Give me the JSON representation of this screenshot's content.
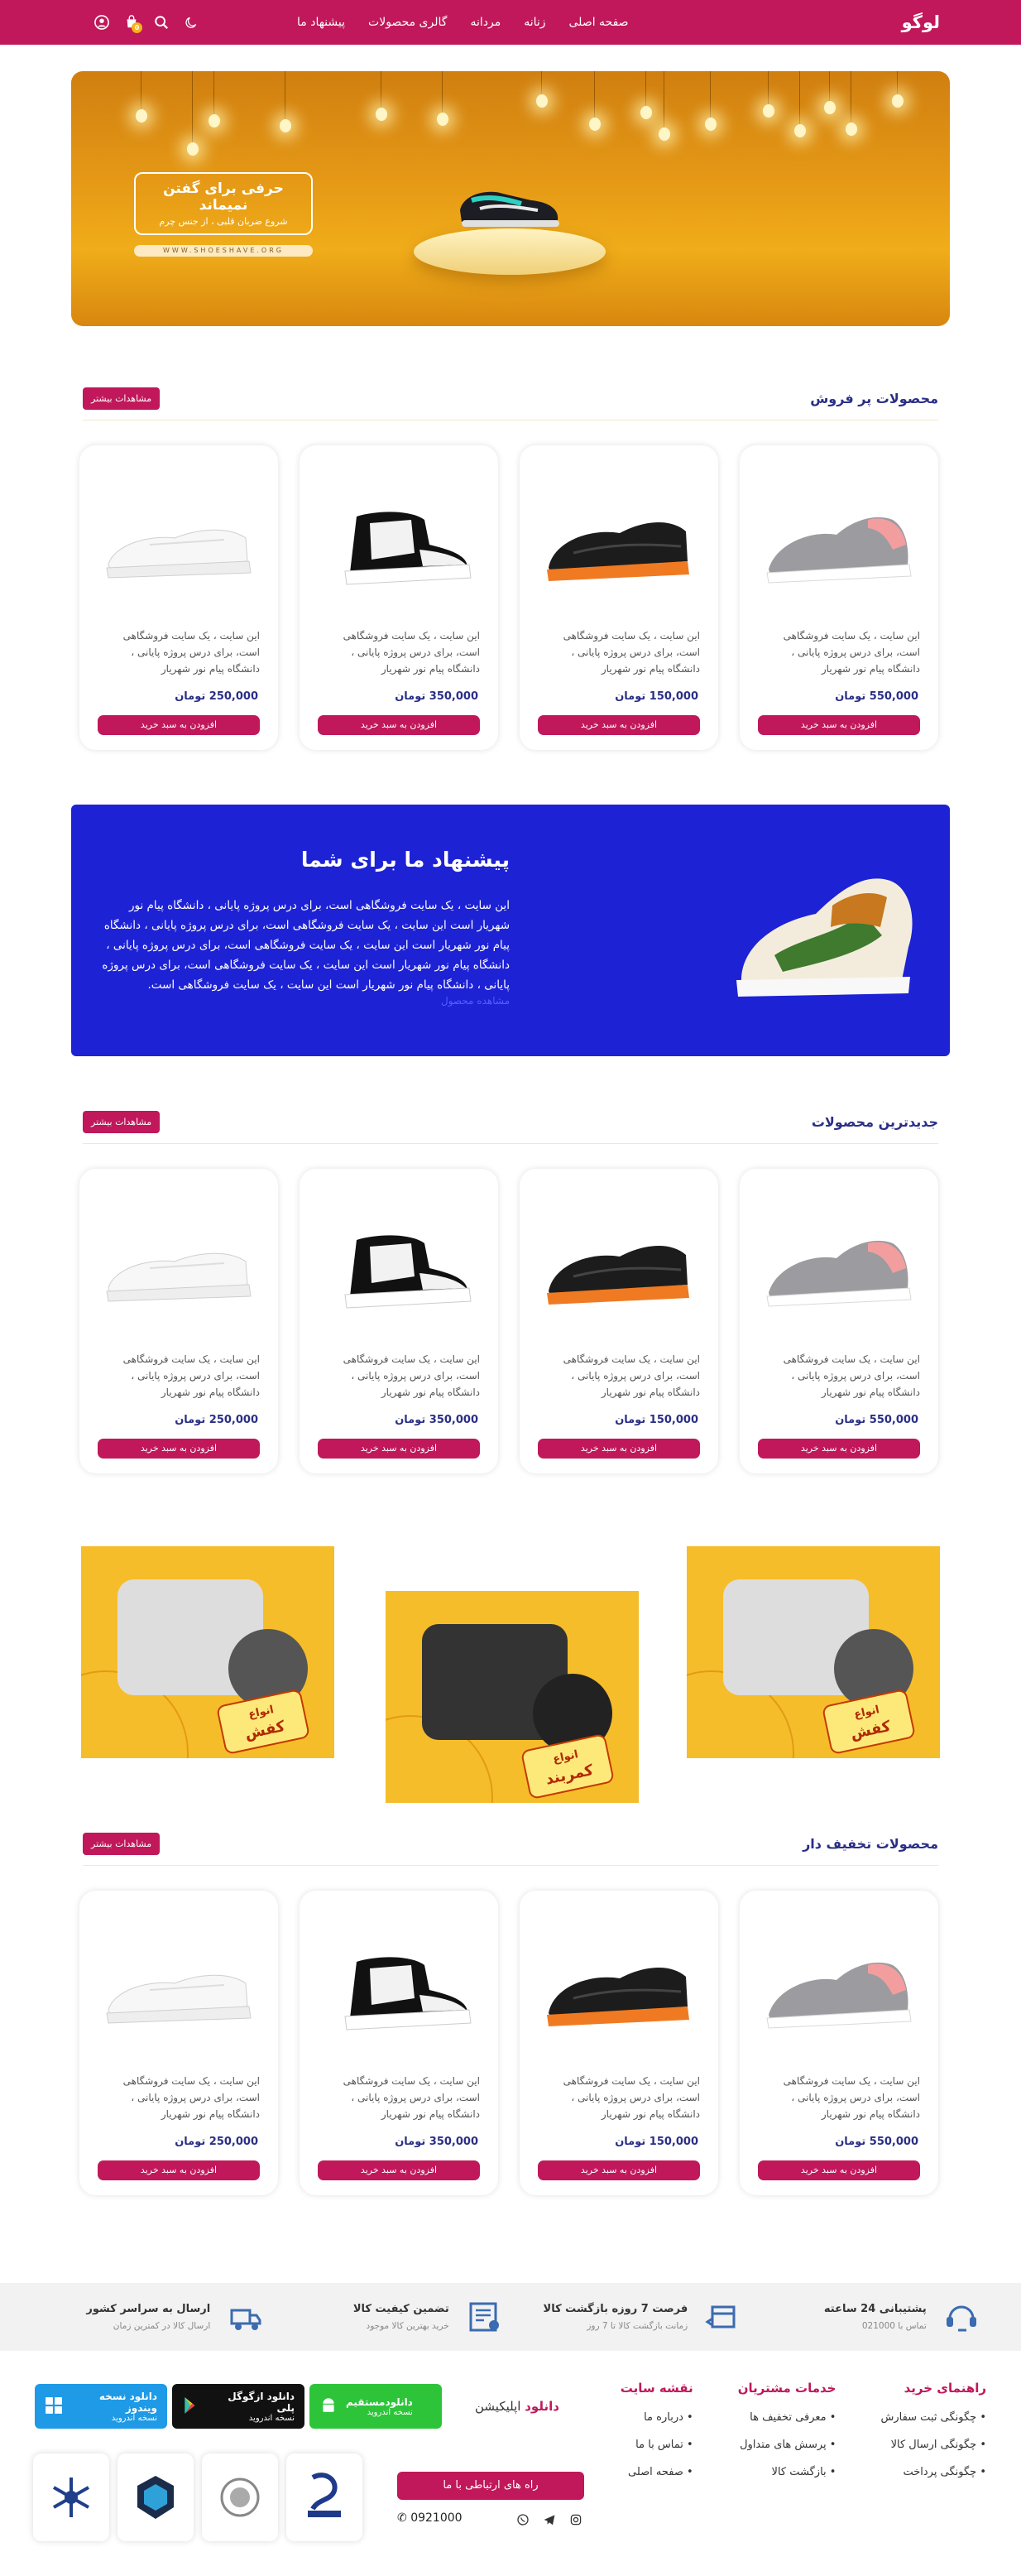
{
  "header": {
    "logo": "لوگو",
    "nav": [
      "صفحه اصلی",
      "زنانه",
      "مردانه",
      "گالری محصولات",
      "پیشنهاد ما"
    ],
    "cart_count": "0"
  },
  "hero": {
    "title": "حرفی برای گفتن نمیماند",
    "subtitle": "شروع ضربان قلبی ، از جنس چرم",
    "url": "WWW.SHOESHAVE.ORG"
  },
  "sections": [
    {
      "title": "محصولات پر فروش",
      "more": "مشاهدات بیشتر"
    },
    {
      "title": "جدیدترین محصولات",
      "more": "مشاهدات بیشتر"
    },
    {
      "title": "محصولات تخفیف دار",
      "more": "مشاهدات بیشتر"
    }
  ],
  "products": [
    {
      "desc": "این سایت ، یک سایت فروشگاهی است، برای درس پروژه پایانی ، دانشگاه پیام نور شهریار",
      "price": "550,000 تومان",
      "cart": "افزودن به سبد خرید"
    },
    {
      "desc": "این سایت ، یک سایت فروشگاهی است، برای درس پروژه پایانی ، دانشگاه پیام نور شهریار",
      "price": "150,000 تومان",
      "cart": "افزودن به سبد خرید"
    },
    {
      "desc": "این سایت ، یک سایت فروشگاهی است، برای درس پروژه پایانی ، دانشگاه پیام نور شهریار",
      "price": "350,000 تومان",
      "cart": "افزودن به سبد خرید"
    },
    {
      "desc": "این سایت ، یک سایت فروشگاهی است، برای درس پروژه پایانی ، دانشگاه پیام نور شهریار",
      "price": "250,000 تومان",
      "cart": "افزودن به سبد خرید"
    }
  ],
  "offer": {
    "title": "پیشنهاد ما برای شما",
    "body": "این سایت ، یک سایت فروشگاهی است، برای درس پروژه پایانی ، دانشگاه پیام نور شهریار است این سایت ، یک سایت فروشگاهی است، برای درس پروژه پایانی ، دانشگاه پیام نور شهریار است این سایت ، یک سایت فروشگاهی است، برای درس پروژه پایانی ، دانشگاه پیام نور شهریار است این سایت ، یک سایت فروشگاهی است، برای درس پروژه پایانی ، دانشگاه پیام نور شهریار است این سایت ، یک سایت فروشگاهی است.",
    "link": "مشاهده محصول"
  },
  "promos": [
    {
      "kind": "انواع",
      "name": "کفش"
    },
    {
      "kind": "انواع",
      "name": "کمربند"
    },
    {
      "kind": "انواع",
      "name": "کفش"
    }
  ],
  "services": [
    {
      "title": "پشتیبانی 24 ساعته",
      "sub": "تماس با 021000",
      "icon": "support-icon"
    },
    {
      "title": "فرصت 7 روزه بازگشت کالا",
      "sub": "زمانت بازگشت کالا تا 7 روز",
      "icon": "return-box-icon"
    },
    {
      "title": "تضمین کیفیت کالا",
      "sub": "خرید بهترین کالا موجود",
      "icon": "quality-certificate-icon"
    },
    {
      "title": "ارسال به سراسر کشور",
      "sub": "ارسال کالا در کمترین زمان",
      "icon": "delivery-truck-icon"
    }
  ],
  "footer": {
    "cols": [
      {
        "title": "راهنمای خرید",
        "items": [
          "چگونگی ثبت سفارش",
          "چگونگی ارسال کالا",
          "چگونگی پرداخت"
        ]
      },
      {
        "title": "خدمات مشتریان",
        "items": [
          "معرفی تخفیف ها",
          "پرسش های متداول",
          "بازگشت کالا"
        ]
      },
      {
        "title": "نقشه سایت",
        "items": [
          "درباره ما",
          "تماس با ما",
          "صفحه اصلی"
        ]
      }
    ],
    "download_label_prefix": "دانلود",
    "download_label": "اپلیکیشن",
    "apps": [
      {
        "title": "دانلودمستقیم",
        "sub": "نسخه اندروید",
        "color": "#2ec43a"
      },
      {
        "title": "دانلود ازگوگل پلی",
        "sub": "نسخه اندروید",
        "color": "#111111"
      },
      {
        "title": "دانلود نسخه ویندوز",
        "sub": "نسخه اندروید",
        "color": "#1e9ae6"
      }
    ],
    "contact": "راه های ارتباطی با ما",
    "phone": "0921000"
  }
}
